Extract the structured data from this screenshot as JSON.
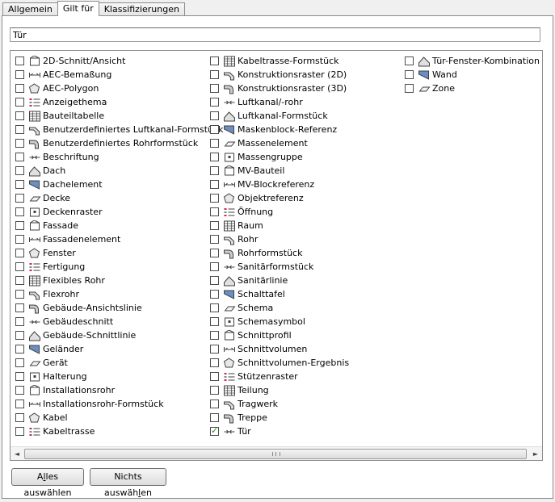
{
  "tabs": [
    {
      "label": "Allgemein",
      "active": false
    },
    {
      "label": "Gilt für",
      "active": true
    },
    {
      "label": "Klassifizierungen",
      "active": false
    }
  ],
  "filter": {
    "value": "Tür"
  },
  "columns": [
    [
      {
        "label": "2D-Schnitt/Ansicht",
        "checked": false,
        "icon": "section-2d-icon"
      },
      {
        "label": "AEC-Bemaßung",
        "checked": false,
        "icon": "dimension-icon"
      },
      {
        "label": "AEC-Polygon",
        "checked": false,
        "icon": "polygon-icon"
      },
      {
        "label": "Anzeigethema",
        "checked": false,
        "icon": "display-theme-icon"
      },
      {
        "label": "Bauteiltabelle",
        "checked": false,
        "icon": "schedule-table-icon"
      },
      {
        "label": "Benutzerdefiniertes Luftkanal-Formstück",
        "checked": false,
        "icon": "custom-duct-fitting-icon"
      },
      {
        "label": "Benutzerdefiniertes Rohrformstück",
        "checked": false,
        "icon": "custom-pipe-fitting-icon"
      },
      {
        "label": "Beschriftung",
        "checked": false,
        "icon": "annotation-icon"
      },
      {
        "label": "Dach",
        "checked": false,
        "icon": "roof-icon"
      },
      {
        "label": "Dachelement",
        "checked": false,
        "icon": "roof-slab-icon"
      },
      {
        "label": "Decke",
        "checked": false,
        "icon": "slab-icon"
      },
      {
        "label": "Deckenraster",
        "checked": false,
        "icon": "ceiling-grid-icon"
      },
      {
        "label": "Fassade",
        "checked": false,
        "icon": "curtain-wall-icon"
      },
      {
        "label": "Fassadenelement",
        "checked": false,
        "icon": "curtain-wall-unit-icon"
      },
      {
        "label": "Fenster",
        "checked": false,
        "icon": "window-icon"
      },
      {
        "label": "Fertigung",
        "checked": false,
        "icon": "fabrication-icon"
      },
      {
        "label": "Flexibles Rohr",
        "checked": false,
        "icon": "flex-pipe-icon"
      },
      {
        "label": "Flexrohr",
        "checked": false,
        "icon": "flex-duct-icon"
      },
      {
        "label": "Gebäude-Ansichtslinie",
        "checked": false,
        "icon": "elevation-line-icon"
      },
      {
        "label": "Gebäudeschnitt",
        "checked": false,
        "icon": "building-section-icon"
      },
      {
        "label": "Gebäude-Schnittlinie",
        "checked": false,
        "icon": "section-line-icon"
      },
      {
        "label": "Geländer",
        "checked": false,
        "icon": "railing-icon"
      },
      {
        "label": "Gerät",
        "checked": false,
        "icon": "device-icon"
      },
      {
        "label": "Halterung",
        "checked": false,
        "icon": "hanger-icon"
      },
      {
        "label": "Installationsrohr",
        "checked": false,
        "icon": "conduit-icon"
      },
      {
        "label": "Installationsrohr-Formstück",
        "checked": false,
        "icon": "conduit-fitting-icon"
      },
      {
        "label": "Kabel",
        "checked": false,
        "icon": "wire-icon"
      },
      {
        "label": "Kabeltrasse",
        "checked": false,
        "icon": "cable-tray-icon"
      }
    ],
    [
      {
        "label": "Kabeltrasse-Formstück",
        "checked": false,
        "icon": "cable-tray-fitting-icon"
      },
      {
        "label": "Konstruktionsraster (2D)",
        "checked": false,
        "icon": "layout-grid-2d-icon"
      },
      {
        "label": "Konstruktionsraster (3D)",
        "checked": false,
        "icon": "layout-grid-3d-icon"
      },
      {
        "label": "Luftkanal/-rohr",
        "checked": false,
        "icon": "duct-icon"
      },
      {
        "label": "Luftkanal-Formstück",
        "checked": false,
        "icon": "duct-fitting-icon"
      },
      {
        "label": "Maskenblock-Referenz",
        "checked": false,
        "icon": "mask-block-icon"
      },
      {
        "label": "Massenelement",
        "checked": false,
        "icon": "mass-element-icon"
      },
      {
        "label": "Massengruppe",
        "checked": false,
        "icon": "mass-group-icon"
      },
      {
        "label": "MV-Bauteil",
        "checked": false,
        "icon": "mv-part-icon"
      },
      {
        "label": "MV-Blockreferenz",
        "checked": false,
        "icon": "mv-block-icon"
      },
      {
        "label": "Objektreferenz",
        "checked": false,
        "icon": "object-reference-icon"
      },
      {
        "label": "Öffnung",
        "checked": false,
        "icon": "opening-icon"
      },
      {
        "label": "Raum",
        "checked": false,
        "icon": "space-icon"
      },
      {
        "label": "Rohr",
        "checked": false,
        "icon": "pipe-icon"
      },
      {
        "label": "Rohrformstück",
        "checked": false,
        "icon": "pipe-fitting-icon"
      },
      {
        "label": "Sanitärformstück",
        "checked": false,
        "icon": "plumbing-fitting-icon"
      },
      {
        "label": "Sanitärlinie",
        "checked": false,
        "icon": "plumbing-line-icon"
      },
      {
        "label": "Schalttafel",
        "checked": false,
        "icon": "panel-icon"
      },
      {
        "label": "Schema",
        "checked": false,
        "icon": "schematic-icon"
      },
      {
        "label": "Schemasymbol",
        "checked": false,
        "icon": "schematic-symbol-icon"
      },
      {
        "label": "Schnittprofil",
        "checked": false,
        "icon": "section-profile-icon"
      },
      {
        "label": "Schnittvolumen",
        "checked": false,
        "icon": "section-volume-icon"
      },
      {
        "label": "Schnittvolumen-Ergebnis",
        "checked": false,
        "icon": "section-volume-result-icon"
      },
      {
        "label": "Stützenraster",
        "checked": false,
        "icon": "column-grid-icon"
      },
      {
        "label": "Teilung",
        "checked": false,
        "icon": "division-icon"
      },
      {
        "label": "Tragwerk",
        "checked": false,
        "icon": "structural-member-icon"
      },
      {
        "label": "Treppe",
        "checked": false,
        "icon": "stair-icon"
      },
      {
        "label": "Tür",
        "checked": true,
        "icon": "door-icon"
      }
    ],
    [
      {
        "label": "Tür-Fenster-Kombination",
        "checked": false,
        "icon": "door-window-assembly-icon"
      },
      {
        "label": "Wand",
        "checked": false,
        "icon": "wall-icon"
      },
      {
        "label": "Zone",
        "checked": false,
        "icon": "zone-icon"
      }
    ]
  ],
  "buttons": {
    "select_all_pre": "A",
    "select_all_u": "l",
    "select_all_post": "les auswählen",
    "select_none_pre": "Nichts auswäh",
    "select_none_u": "l",
    "select_none_post": "en"
  },
  "scroll": {
    "left_arrow": "◄",
    "right_arrow": "►"
  },
  "colors": {
    "check": "#2a8a2a",
    "icon_stroke": "#404040",
    "icon_fill": "#6a8fc0"
  }
}
